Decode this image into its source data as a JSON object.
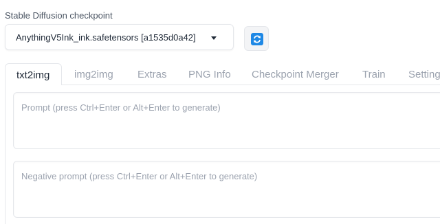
{
  "checkpoint": {
    "label": "Stable Diffusion checkpoint",
    "selected": "AnythingV5Ink_ink.safetensors [a1535d0a42]",
    "dropdown_icon": "chevron-down-icon",
    "refresh_icon": "refresh-icon",
    "accent_color": "#1e88e5"
  },
  "tabs": [
    {
      "label": "txt2img",
      "active": true
    },
    {
      "label": "img2img"
    },
    {
      "label": "Extras"
    },
    {
      "label": "PNG Info"
    },
    {
      "label": "Checkpoint Merger"
    },
    {
      "label": "Train"
    },
    {
      "label": "Settings"
    }
  ],
  "prompt": {
    "placeholder": "Prompt (press Ctrl+Enter or Alt+Enter to generate)"
  },
  "negative_prompt": {
    "placeholder": "Negative prompt (press Ctrl+Enter or Alt+Enter to generate)"
  }
}
